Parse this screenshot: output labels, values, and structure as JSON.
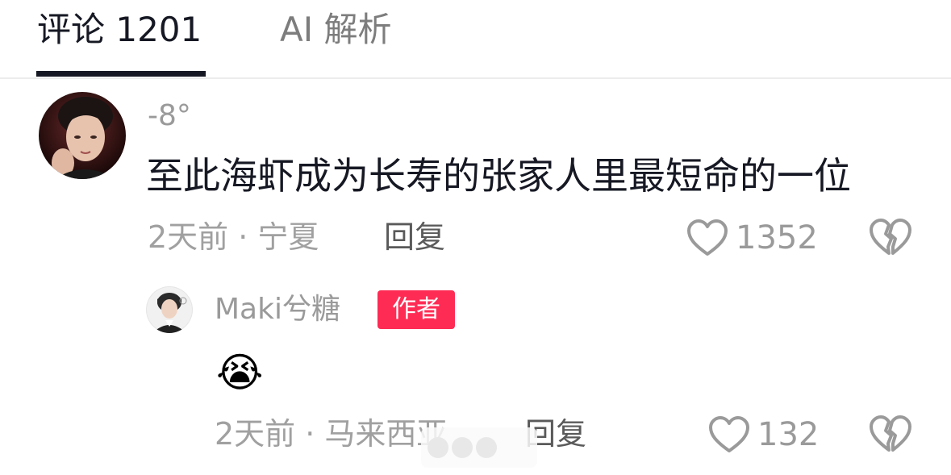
{
  "tabs": [
    {
      "label": "评论 1201",
      "active": true
    },
    {
      "label": "AI 解析",
      "active": false
    }
  ],
  "comment": {
    "username": "-8°",
    "text": "至此海虾成为长寿的张家人里最短命的一位",
    "meta": "2天前 · 宁夏",
    "reply_label": "回复",
    "like_count": "1352"
  },
  "reply": {
    "username": "Maki兮糖",
    "badge": "作者",
    "emoji": "😭",
    "meta": "2天前 · 马来西亚",
    "reply_label": "回复",
    "like_count": "132"
  },
  "colors": {
    "accent": "#fe2c55",
    "text_primary": "#161823",
    "text_secondary": "#9a9a9a"
  },
  "icons": [
    "heart-outline-icon",
    "broken-heart-icon"
  ]
}
